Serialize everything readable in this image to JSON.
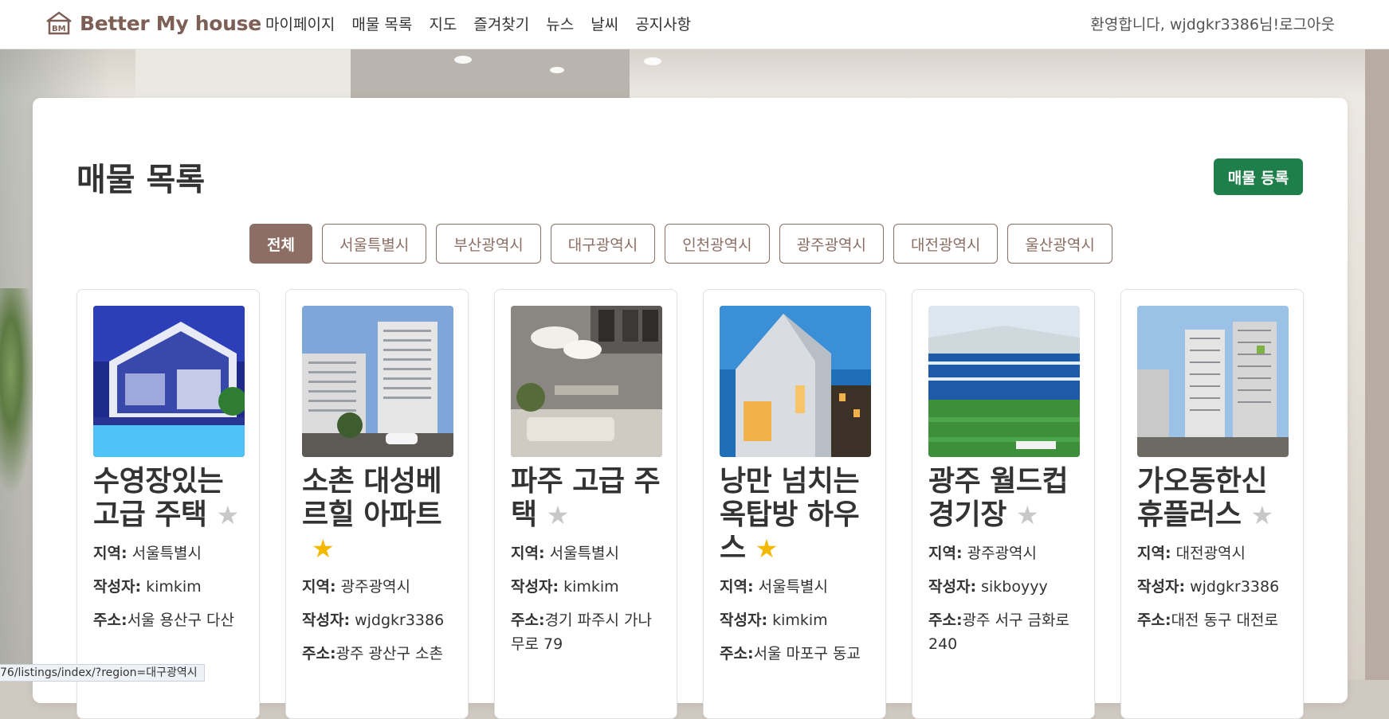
{
  "header": {
    "brand": "Better My house",
    "nav": [
      "마이페이지",
      "매물 목록",
      "지도",
      "즐겨찾기",
      "뉴스",
      "날씨",
      "공지사항"
    ],
    "welcome": "환영합니다, wjdgkr3386님!",
    "logout": "로그아웃"
  },
  "main": {
    "title": "매물 목록",
    "add_button": "매물 등록",
    "filters": [
      "전체",
      "서울특별시",
      "부산광역시",
      "대구광역시",
      "인천광역시",
      "광주광역시",
      "대전광역시",
      "울산광역시"
    ],
    "active_filter": "전체",
    "labels": {
      "region": "지역:",
      "author": "작성자:",
      "address": "주소:"
    },
    "listings": [
      {
        "title": "수영장있는 고급 주택",
        "favorite": false,
        "region": "서울특별시",
        "author": "kimkim",
        "address": "서울 용산구 다산"
      },
      {
        "title": "소촌 대성베르힐 아파트",
        "favorite": true,
        "region": "광주광역시",
        "author": "wjdgkr3386",
        "address": "광주 광산구 소촌"
      },
      {
        "title": "파주 고급 주택",
        "favorite": false,
        "region": "서울특별시",
        "author": "kimkim",
        "address": "경기 파주시 가나무로 79"
      },
      {
        "title": "낭만 넘치는 옥탑방 하우스",
        "favorite": true,
        "region": "서울특별시",
        "author": "kimkim",
        "address": "서울 마포구 동교"
      },
      {
        "title": "광주 월드컵 경기장",
        "favorite": false,
        "region": "광주광역시",
        "author": "sikboyyy",
        "address": "광주 서구 금화로 240"
      },
      {
        "title": "가오동한신휴플러스",
        "favorite": false,
        "region": "대전광역시",
        "author": "wjdgkr3386",
        "address": "대전 동구 대전로"
      }
    ]
  },
  "status_url": "76/listings/index/?region=대구광역시",
  "colors": {
    "brand": "#7d5f55",
    "filter": "#8c6e64",
    "add_button": "#1e7f4a",
    "star_on": "#f5b800",
    "star_off": "#c8c8c8"
  }
}
